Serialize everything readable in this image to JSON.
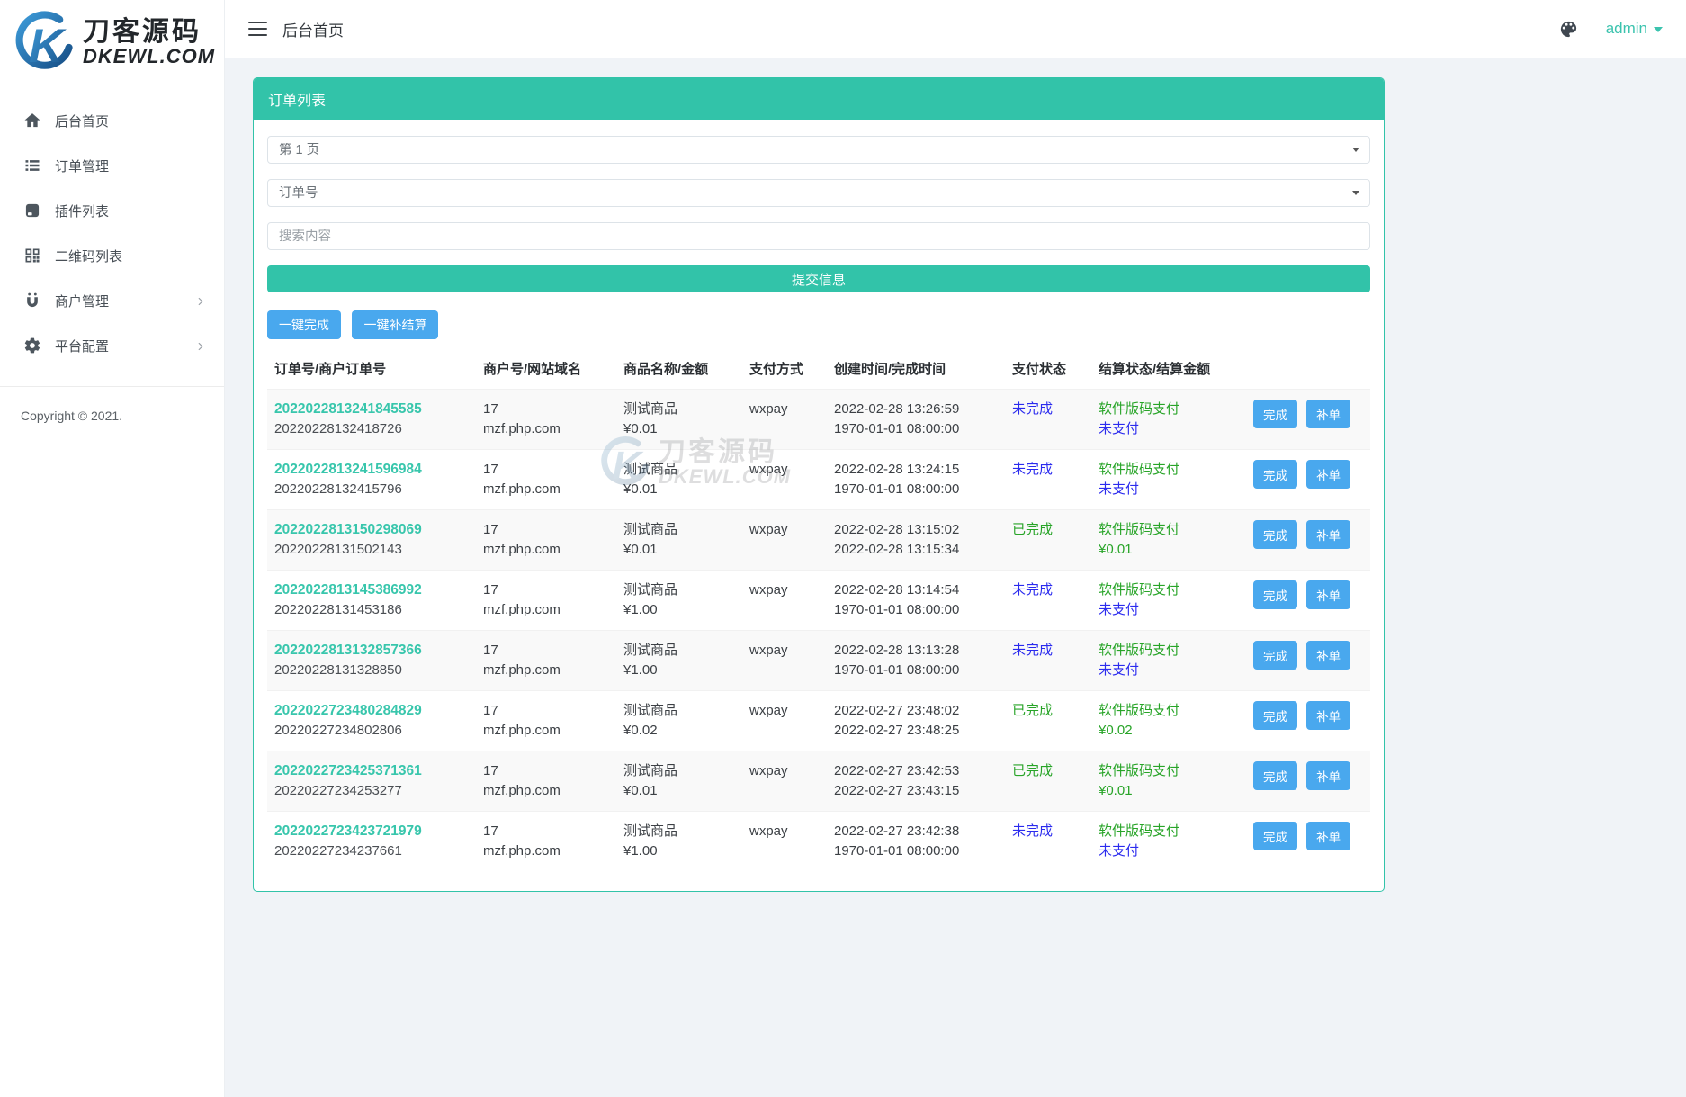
{
  "colors": {
    "accent_teal": "#32c3a9",
    "button_blue": "#49a8ee",
    "link_teal": "#38c6ac",
    "status_green": "#28a428",
    "status_blue": "#2b2bee"
  },
  "logo": {
    "brand_cn": "刀客源码",
    "brand_en": "DKEWL.COM",
    "mark": "k-swoosh-logo"
  },
  "header": {
    "title": "后台首页",
    "user": "admin"
  },
  "sidebar": {
    "items": [
      {
        "label": "后台首页",
        "icon": "home-icon",
        "expandable": false
      },
      {
        "label": "订单管理",
        "icon": "order-list-icon",
        "expandable": false
      },
      {
        "label": "插件列表",
        "icon": "plugin-icon",
        "expandable": false
      },
      {
        "label": "二维码列表",
        "icon": "qrcode-icon",
        "expandable": false
      },
      {
        "label": "商户管理",
        "icon": "merchant-icon",
        "expandable": true
      },
      {
        "label": "平台配置",
        "icon": "gear-icon",
        "expandable": true
      }
    ],
    "copyright": "Copyright © 2021."
  },
  "panel": {
    "title": "订单列表",
    "filters": {
      "page_select": "第 1 页",
      "field_select": "订单号",
      "search_placeholder": "搜索内容"
    },
    "submit_label": "提交信息",
    "bulk_buttons": [
      {
        "label": "一键完成"
      },
      {
        "label": "一键补结算"
      }
    ],
    "table": {
      "headers": [
        "订单号/商户订单号",
        "商户号/网站域名",
        "商品名称/金额",
        "支付方式",
        "创建时间/完成时间",
        "支付状态",
        "结算状态/结算金额"
      ],
      "row_actions": [
        "完成",
        "补单"
      ],
      "rows": [
        {
          "order_no": "2022022813241845585",
          "merchant_order_no": "20220228132418726",
          "merchant_no": "17",
          "domain": "mzf.php.com",
          "product": "测试商品",
          "amount": "¥0.01",
          "pay_method": "wxpay",
          "created_at": "2022-02-28 13:26:59",
          "finished_at": "1970-01-01 08:00:00",
          "pay_status": "未完成",
          "pay_status_color": "blue",
          "settle_status": "软件版码支付",
          "settle_value": "未支付",
          "settle_value_color": "blue"
        },
        {
          "order_no": "2022022813241596984",
          "merchant_order_no": "20220228132415796",
          "merchant_no": "17",
          "domain": "mzf.php.com",
          "product": "测试商品",
          "amount": "¥0.01",
          "pay_method": "wxpay",
          "created_at": "2022-02-28 13:24:15",
          "finished_at": "1970-01-01 08:00:00",
          "pay_status": "未完成",
          "pay_status_color": "blue",
          "settle_status": "软件版码支付",
          "settle_value": "未支付",
          "settle_value_color": "blue"
        },
        {
          "order_no": "2022022813150298069",
          "merchant_order_no": "20220228131502143",
          "merchant_no": "17",
          "domain": "mzf.php.com",
          "product": "测试商品",
          "amount": "¥0.01",
          "pay_method": "wxpay",
          "created_at": "2022-02-28 13:15:02",
          "finished_at": "2022-02-28 13:15:34",
          "pay_status": "已完成",
          "pay_status_color": "green",
          "settle_status": "软件版码支付",
          "settle_value": "¥0.01",
          "settle_value_color": "green"
        },
        {
          "order_no": "2022022813145386992",
          "merchant_order_no": "20220228131453186",
          "merchant_no": "17",
          "domain": "mzf.php.com",
          "product": "测试商品",
          "amount": "¥1.00",
          "pay_method": "wxpay",
          "created_at": "2022-02-28 13:14:54",
          "finished_at": "1970-01-01 08:00:00",
          "pay_status": "未完成",
          "pay_status_color": "blue",
          "settle_status": "软件版码支付",
          "settle_value": "未支付",
          "settle_value_color": "blue"
        },
        {
          "order_no": "2022022813132857366",
          "merchant_order_no": "20220228131328850",
          "merchant_no": "17",
          "domain": "mzf.php.com",
          "product": "测试商品",
          "amount": "¥1.00",
          "pay_method": "wxpay",
          "created_at": "2022-02-28 13:13:28",
          "finished_at": "1970-01-01 08:00:00",
          "pay_status": "未完成",
          "pay_status_color": "blue",
          "settle_status": "软件版码支付",
          "settle_value": "未支付",
          "settle_value_color": "blue"
        },
        {
          "order_no": "2022022723480284829",
          "merchant_order_no": "20220227234802806",
          "merchant_no": "17",
          "domain": "mzf.php.com",
          "product": "测试商品",
          "amount": "¥0.02",
          "pay_method": "wxpay",
          "created_at": "2022-02-27 23:48:02",
          "finished_at": "2022-02-27 23:48:25",
          "pay_status": "已完成",
          "pay_status_color": "green",
          "settle_status": "软件版码支付",
          "settle_value": "¥0.02",
          "settle_value_color": "green"
        },
        {
          "order_no": "2022022723425371361",
          "merchant_order_no": "20220227234253277",
          "merchant_no": "17",
          "domain": "mzf.php.com",
          "product": "测试商品",
          "amount": "¥0.01",
          "pay_method": "wxpay",
          "created_at": "2022-02-27 23:42:53",
          "finished_at": "2022-02-27 23:43:15",
          "pay_status": "已完成",
          "pay_status_color": "green",
          "settle_status": "软件版码支付",
          "settle_value": "¥0.01",
          "settle_value_color": "green"
        },
        {
          "order_no": "2022022723423721979",
          "merchant_order_no": "20220227234237661",
          "merchant_no": "17",
          "domain": "mzf.php.com",
          "product": "测试商品",
          "amount": "¥1.00",
          "pay_method": "wxpay",
          "created_at": "2022-02-27 23:42:38",
          "finished_at": "1970-01-01 08:00:00",
          "pay_status": "未完成",
          "pay_status_color": "blue",
          "settle_status": "软件版码支付",
          "settle_value": "未支付",
          "settle_value_color": "blue"
        }
      ]
    }
  },
  "watermark": {
    "brand_cn": "刀客源码",
    "brand_en": "DKEWL.COM"
  }
}
